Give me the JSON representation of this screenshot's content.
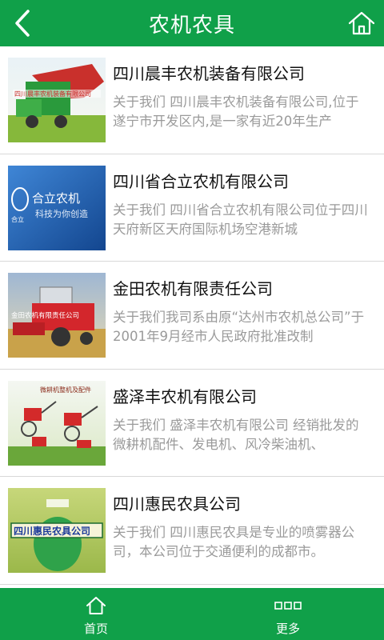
{
  "header": {
    "title": "农机农具",
    "back_icon": "chevron-left-icon",
    "home_icon": "home-icon"
  },
  "list": [
    {
      "name": "四川晨丰农机装备有限公司",
      "desc": "关于我们 四川晨丰农机装备有限公司,位于遂宁市开发区内,是一家有近20年生产",
      "thumb_caption": "四川晨丰农机装备有限公司"
    },
    {
      "name": "四川省合立农机有限公司",
      "desc": "关于我们 四川省合立农机有限公司位于四川天府新区天府国际机场空港新城",
      "thumb_caption": "合立农机",
      "thumb_sub": "科技为你创造",
      "thumb_logo": "合立"
    },
    {
      "name": "金田农机有限责任公司",
      "desc": "关于我们我司系由原“达州市农机总公司”于2001年9月经市人民政府批准改制",
      "thumb_caption": "金田农机有限责任公司"
    },
    {
      "name": "盛泽丰农机有限公司",
      "desc": "关于我们 盛泽丰农机有限公司 经销批发的微耕机配件、发电机、风冷柴油机、",
      "thumb_caption": "微耕机整机及配件"
    },
    {
      "name": "四川惠民农具公司",
      "desc": "关于我们 四川惠民农具是专业的喷雾器公司，本公司位于交通便利的成都市。",
      "thumb_caption": "四川惠民农具公司"
    }
  ],
  "tabbar": [
    {
      "label": "首页",
      "icon": "home-icon"
    },
    {
      "label": "更多",
      "icon": "more-squares-icon"
    }
  ],
  "colors": {
    "brand_green": "#10a049",
    "desc_gray": "#9a9a9a",
    "divider": "#d8d8d8"
  }
}
